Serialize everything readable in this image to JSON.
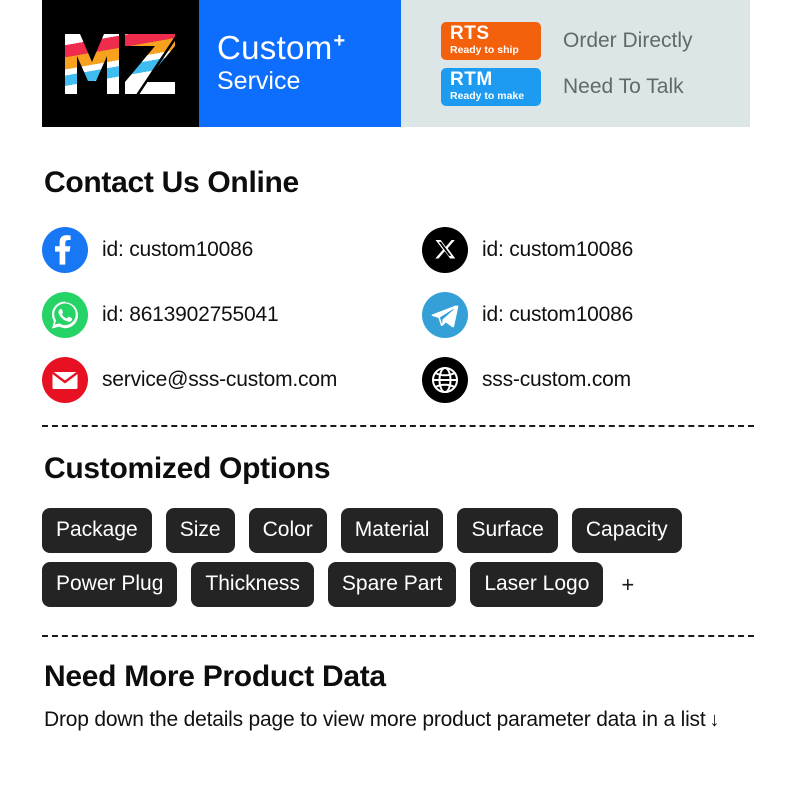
{
  "banner": {
    "logo_text": "MZ",
    "logo_icon": "mz-logo-icon",
    "title_line1": "Custom",
    "title_superscript": "+",
    "title_line2": "Service",
    "badges": [
      {
        "code": "RTS",
        "caption": "Ready to ship",
        "note": "Order Directly",
        "color": "#f4610c"
      },
      {
        "code": "RTM",
        "caption": "Ready to make",
        "note": "Need To Talk",
        "color": "#1d9bf0"
      }
    ]
  },
  "contact": {
    "heading": "Contact Us Online",
    "items": [
      {
        "icon": "facebook-icon",
        "color": "#1877f2",
        "text": "id: custom10086"
      },
      {
        "icon": "x-twitter-icon",
        "color": "#000000",
        "text": "id: custom10086"
      },
      {
        "icon": "whatsapp-icon",
        "color": "#25d366",
        "text": "id: 8613902755041"
      },
      {
        "icon": "telegram-icon",
        "color": "#35a0d8",
        "text": "id: custom10086"
      },
      {
        "icon": "email-icon",
        "color": "#e81123",
        "text": "service@sss-custom.com"
      },
      {
        "icon": "globe-icon",
        "color": "#000000",
        "text": "sss-custom.com"
      }
    ]
  },
  "options": {
    "heading": "Customized Options",
    "chips": [
      "Package",
      "Size",
      "Color",
      "Material",
      "Surface",
      "Capacity",
      "Power Plug",
      "Thickness",
      "Spare Part",
      "Laser Logo"
    ],
    "more_symbol": "+"
  },
  "product_data": {
    "heading": "Need More Product Data",
    "body": "Drop down the details page to view more product parameter data in a list",
    "arrow": "↓"
  }
}
